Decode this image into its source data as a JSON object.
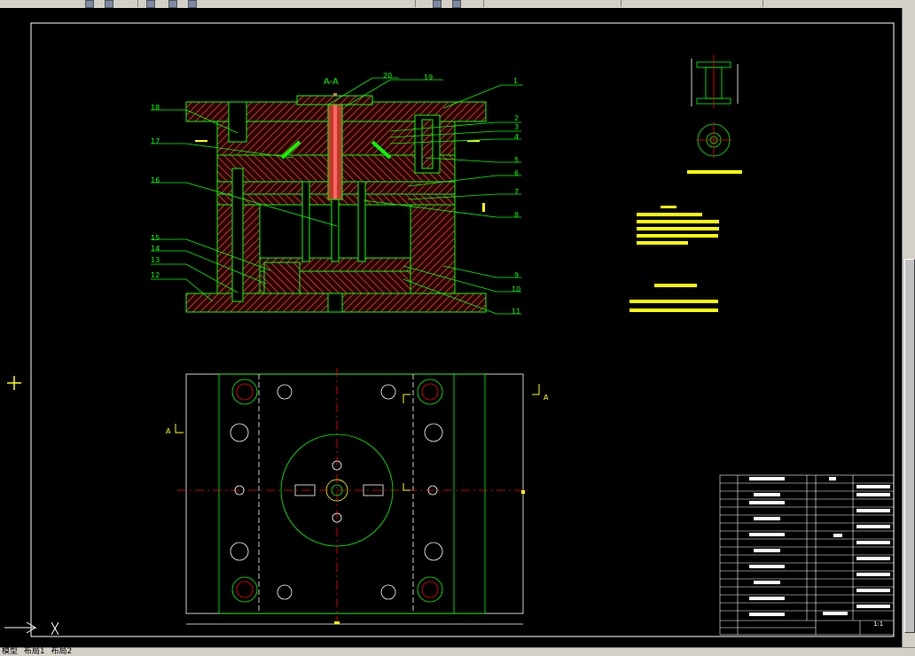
{
  "drawing": {
    "section_title": "A-A",
    "section_marker": "A",
    "part_numbers": [
      "1",
      "2",
      "3",
      "4",
      "5",
      "6",
      "7",
      "8",
      "9",
      "10",
      "11",
      "12",
      "13",
      "14",
      "15",
      "16",
      "17",
      "18",
      "19",
      "20"
    ],
    "scale": "1:1"
  },
  "tabs": {
    "model": "模型",
    "layout1": "布局1",
    "layout2": "布局2"
  },
  "colors": {
    "background": "#000000",
    "outline": "#00ff00",
    "hatch": "#ff3333",
    "centerline": "#ff0000",
    "annotation": "#ffff00",
    "text": "#ffffff"
  }
}
